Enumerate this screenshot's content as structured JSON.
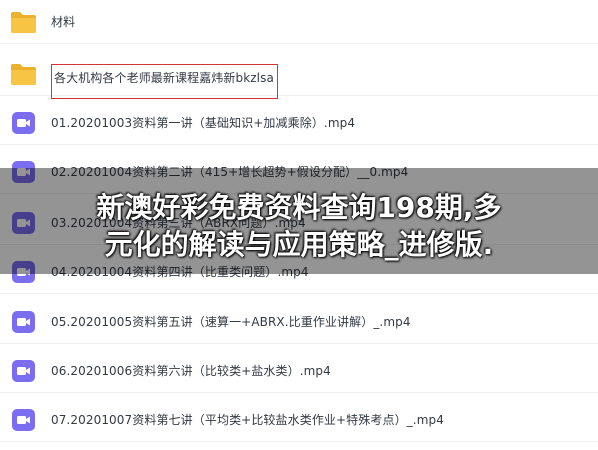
{
  "files": [
    {
      "name": "材料",
      "type": "folder"
    },
    {
      "name": "各大机构各个老师最新课程嘉炜新bkzlsa",
      "type": "folder",
      "highlighted": true
    },
    {
      "name": "01.20201003资料第一讲（基础知识+加减乘除）.mp4",
      "type": "video"
    },
    {
      "name": "02.20201004资料第二讲（415+增长超势+假设分配）__0.mp4",
      "type": "video"
    },
    {
      "name": "03.20201004资料第三讲（ABRX问题）.mp4",
      "type": "video"
    },
    {
      "name": "04.20201004资料第四讲（比重类问题）.mp4",
      "type": "video"
    },
    {
      "name": "05.20201005资料第五讲（速算一+ABRX.比重作业讲解）_.mp4",
      "type": "video"
    },
    {
      "name": "06.20201006资料第六讲（比较类+盐水类）.mp4",
      "type": "video"
    },
    {
      "name": "07.20201007资料第七讲（平均类+比较盐水类作业+特殊考点）_.mp4",
      "type": "video"
    }
  ],
  "overlay": {
    "line1": "新澳好彩免费资料查询198期,多",
    "line2": "元化的解读与应用策略_进修版."
  },
  "colors": {
    "folder": "#f7c443",
    "folder_dark": "#eab12c",
    "video": "#7a6df0",
    "highlight_border": "#d23535"
  }
}
